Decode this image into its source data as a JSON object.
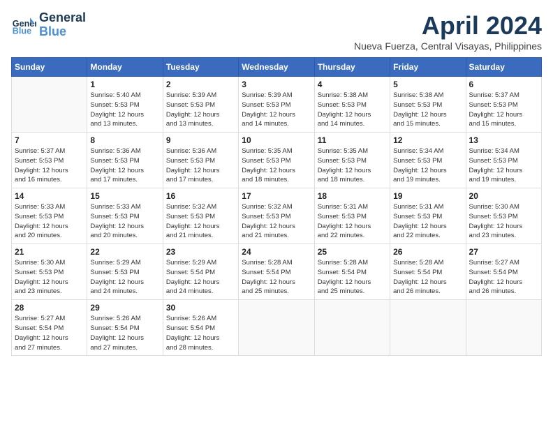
{
  "header": {
    "logo_line1": "General",
    "logo_line2": "Blue",
    "month_title": "April 2024",
    "subtitle": "Nueva Fuerza, Central Visayas, Philippines"
  },
  "columns": [
    "Sunday",
    "Monday",
    "Tuesday",
    "Wednesday",
    "Thursday",
    "Friday",
    "Saturday"
  ],
  "weeks": [
    [
      {
        "day": "",
        "info": ""
      },
      {
        "day": "1",
        "info": "Sunrise: 5:40 AM\nSunset: 5:53 PM\nDaylight: 12 hours\nand 13 minutes."
      },
      {
        "day": "2",
        "info": "Sunrise: 5:39 AM\nSunset: 5:53 PM\nDaylight: 12 hours\nand 13 minutes."
      },
      {
        "day": "3",
        "info": "Sunrise: 5:39 AM\nSunset: 5:53 PM\nDaylight: 12 hours\nand 14 minutes."
      },
      {
        "day": "4",
        "info": "Sunrise: 5:38 AM\nSunset: 5:53 PM\nDaylight: 12 hours\nand 14 minutes."
      },
      {
        "day": "5",
        "info": "Sunrise: 5:38 AM\nSunset: 5:53 PM\nDaylight: 12 hours\nand 15 minutes."
      },
      {
        "day": "6",
        "info": "Sunrise: 5:37 AM\nSunset: 5:53 PM\nDaylight: 12 hours\nand 15 minutes."
      }
    ],
    [
      {
        "day": "7",
        "info": "Sunrise: 5:37 AM\nSunset: 5:53 PM\nDaylight: 12 hours\nand 16 minutes."
      },
      {
        "day": "8",
        "info": "Sunrise: 5:36 AM\nSunset: 5:53 PM\nDaylight: 12 hours\nand 17 minutes."
      },
      {
        "day": "9",
        "info": "Sunrise: 5:36 AM\nSunset: 5:53 PM\nDaylight: 12 hours\nand 17 minutes."
      },
      {
        "day": "10",
        "info": "Sunrise: 5:35 AM\nSunset: 5:53 PM\nDaylight: 12 hours\nand 18 minutes."
      },
      {
        "day": "11",
        "info": "Sunrise: 5:35 AM\nSunset: 5:53 PM\nDaylight: 12 hours\nand 18 minutes."
      },
      {
        "day": "12",
        "info": "Sunrise: 5:34 AM\nSunset: 5:53 PM\nDaylight: 12 hours\nand 19 minutes."
      },
      {
        "day": "13",
        "info": "Sunrise: 5:34 AM\nSunset: 5:53 PM\nDaylight: 12 hours\nand 19 minutes."
      }
    ],
    [
      {
        "day": "14",
        "info": "Sunrise: 5:33 AM\nSunset: 5:53 PM\nDaylight: 12 hours\nand 20 minutes."
      },
      {
        "day": "15",
        "info": "Sunrise: 5:33 AM\nSunset: 5:53 PM\nDaylight: 12 hours\nand 20 minutes."
      },
      {
        "day": "16",
        "info": "Sunrise: 5:32 AM\nSunset: 5:53 PM\nDaylight: 12 hours\nand 21 minutes."
      },
      {
        "day": "17",
        "info": "Sunrise: 5:32 AM\nSunset: 5:53 PM\nDaylight: 12 hours\nand 21 minutes."
      },
      {
        "day": "18",
        "info": "Sunrise: 5:31 AM\nSunset: 5:53 PM\nDaylight: 12 hours\nand 22 minutes."
      },
      {
        "day": "19",
        "info": "Sunrise: 5:31 AM\nSunset: 5:53 PM\nDaylight: 12 hours\nand 22 minutes."
      },
      {
        "day": "20",
        "info": "Sunrise: 5:30 AM\nSunset: 5:53 PM\nDaylight: 12 hours\nand 23 minutes."
      }
    ],
    [
      {
        "day": "21",
        "info": "Sunrise: 5:30 AM\nSunset: 5:53 PM\nDaylight: 12 hours\nand 23 minutes."
      },
      {
        "day": "22",
        "info": "Sunrise: 5:29 AM\nSunset: 5:53 PM\nDaylight: 12 hours\nand 24 minutes."
      },
      {
        "day": "23",
        "info": "Sunrise: 5:29 AM\nSunset: 5:54 PM\nDaylight: 12 hours\nand 24 minutes."
      },
      {
        "day": "24",
        "info": "Sunrise: 5:28 AM\nSunset: 5:54 PM\nDaylight: 12 hours\nand 25 minutes."
      },
      {
        "day": "25",
        "info": "Sunrise: 5:28 AM\nSunset: 5:54 PM\nDaylight: 12 hours\nand 25 minutes."
      },
      {
        "day": "26",
        "info": "Sunrise: 5:28 AM\nSunset: 5:54 PM\nDaylight: 12 hours\nand 26 minutes."
      },
      {
        "day": "27",
        "info": "Sunrise: 5:27 AM\nSunset: 5:54 PM\nDaylight: 12 hours\nand 26 minutes."
      }
    ],
    [
      {
        "day": "28",
        "info": "Sunrise: 5:27 AM\nSunset: 5:54 PM\nDaylight: 12 hours\nand 27 minutes."
      },
      {
        "day": "29",
        "info": "Sunrise: 5:26 AM\nSunset: 5:54 PM\nDaylight: 12 hours\nand 27 minutes."
      },
      {
        "day": "30",
        "info": "Sunrise: 5:26 AM\nSunset: 5:54 PM\nDaylight: 12 hours\nand 28 minutes."
      },
      {
        "day": "",
        "info": ""
      },
      {
        "day": "",
        "info": ""
      },
      {
        "day": "",
        "info": ""
      },
      {
        "day": "",
        "info": ""
      }
    ]
  ]
}
